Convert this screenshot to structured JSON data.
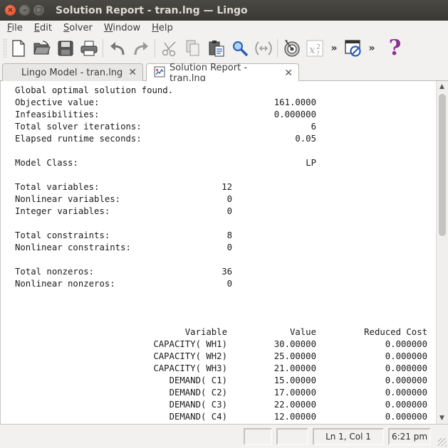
{
  "window": {
    "title": "Solution Report - tran.lng — Lingo",
    "close_glyph": "×",
    "min_glyph": "–",
    "max_glyph": "□"
  },
  "menu": [
    "File",
    "Edit",
    "Solver",
    "Window",
    "Help"
  ],
  "menu_underline": [
    "F",
    "E",
    "S",
    "W",
    "H"
  ],
  "toolbar": {
    "icons": [
      "new-file-icon",
      "open-folder-icon",
      "save-icon",
      "print-icon",
      "undo-icon",
      "redo-icon",
      "cut-icon",
      "copy-icon",
      "paste-icon",
      "find-icon",
      "match-parenthesis-icon",
      "solve-target-icon",
      "options-icon",
      "close-all-icon",
      "help-icon"
    ],
    "more_glyph": "»",
    "help_glyph": "?"
  },
  "tabs": [
    {
      "label": "Lingo Model - tran.lng",
      "active": false,
      "close": "✕"
    },
    {
      "label": "Solution Report - tran.lng",
      "active": true,
      "close": "✕"
    }
  ],
  "report": {
    "header": "Global optimal solution found.",
    "summary": [
      {
        "label": "Objective value:",
        "value": "161.0000"
      },
      {
        "label": "Infeasibilities:",
        "value": "0.000000"
      },
      {
        "label": "Total solver iterations:",
        "value": "6"
      },
      {
        "label": "Elapsed runtime seconds:",
        "value": "0.05"
      }
    ],
    "model_class": {
      "label": "Model Class:",
      "value": "LP"
    },
    "variables": [
      {
        "label": "Total variables:",
        "value": "12"
      },
      {
        "label": "Nonlinear variables:",
        "value": "0"
      },
      {
        "label": "Integer variables:",
        "value": "0"
      }
    ],
    "constraints": [
      {
        "label": "Total constraints:",
        "value": "8"
      },
      {
        "label": "Nonlinear constraints:",
        "value": "0"
      }
    ],
    "nonzeros": [
      {
        "label": "Total nonzeros:",
        "value": "36"
      },
      {
        "label": "Nonlinear nonzeros:",
        "value": "0"
      }
    ],
    "table": {
      "headers": [
        "Variable",
        "Value",
        "Reduced Cost"
      ],
      "rows": [
        [
          "CAPACITY( WH1)",
          "30.00000",
          "0.000000"
        ],
        [
          "CAPACITY( WH2)",
          "25.00000",
          "0.000000"
        ],
        [
          "CAPACITY( WH3)",
          "21.00000",
          "0.000000"
        ],
        [
          "DEMAND( C1)",
          "15.00000",
          "0.000000"
        ],
        [
          "DEMAND( C2)",
          "17.00000",
          "0.000000"
        ],
        [
          "DEMAND( C3)",
          "22.00000",
          "0.000000"
        ],
        [
          "DEMAND( C4)",
          "12.00000",
          "0.000000"
        ]
      ]
    }
  },
  "status": {
    "cell1": "",
    "cell2": "",
    "position": "Ln 1, Col 1",
    "time": "6:21 pm"
  },
  "colors": {
    "titlebar": "#3c3b37",
    "close_button": "#e95420",
    "help_icon": "#8b2f8f"
  }
}
